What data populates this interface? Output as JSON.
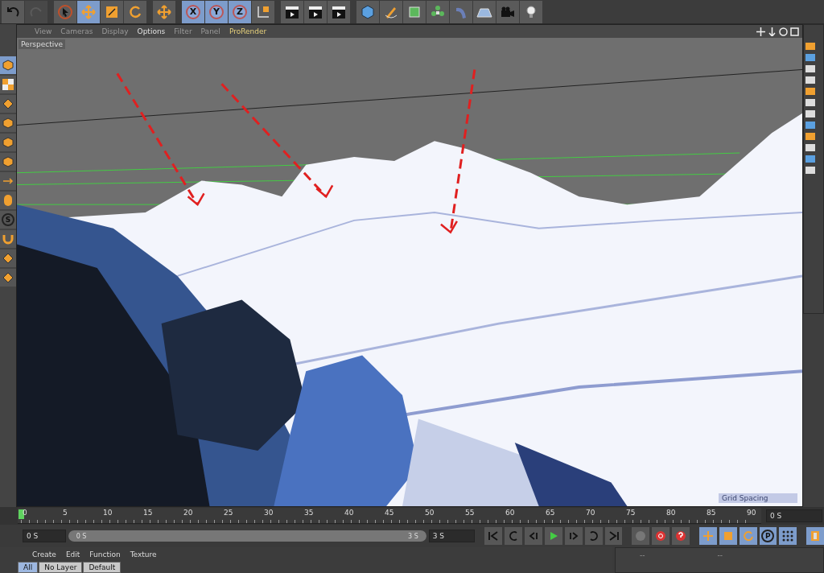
{
  "toolbar": [
    {
      "kind": "undo",
      "selected": false,
      "disabled": false
    },
    {
      "kind": "redo",
      "selected": false,
      "disabled": true
    },
    {
      "kind": "sep"
    },
    {
      "kind": "select",
      "selected": false,
      "disabled": false
    },
    {
      "kind": "move",
      "selected": true,
      "disabled": false
    },
    {
      "kind": "scale",
      "selected": false,
      "disabled": false
    },
    {
      "kind": "rotate",
      "selected": false,
      "disabled": false
    },
    {
      "kind": "sep"
    },
    {
      "kind": "move",
      "selected": false,
      "disabled": false
    },
    {
      "kind": "sep"
    },
    {
      "kind": "axis",
      "label": "X",
      "selected": true,
      "disabled": false
    },
    {
      "kind": "axis",
      "label": "Y",
      "selected": true,
      "disabled": false
    },
    {
      "kind": "axis",
      "label": "Z",
      "selected": true,
      "disabled": false
    },
    {
      "kind": "coords",
      "selected": false,
      "disabled": false
    },
    {
      "kind": "sep"
    },
    {
      "kind": "render",
      "selected": false,
      "disabled": false
    },
    {
      "kind": "render",
      "selected": false,
      "disabled": false
    },
    {
      "kind": "render",
      "selected": false,
      "disabled": false
    },
    {
      "kind": "sep"
    },
    {
      "kind": "cube",
      "selected": false,
      "disabled": false
    },
    {
      "kind": "pen",
      "selected": false,
      "disabled": false
    },
    {
      "kind": "subdiv",
      "selected": false,
      "disabled": false
    },
    {
      "kind": "cloner",
      "selected": false,
      "disabled": false
    },
    {
      "kind": "deformer",
      "selected": false,
      "disabled": false
    },
    {
      "kind": "floor",
      "selected": false,
      "disabled": false
    },
    {
      "kind": "camera",
      "selected": false,
      "disabled": false
    },
    {
      "kind": "light",
      "selected": false,
      "disabled": false
    }
  ],
  "left_tools": [
    {
      "kind": "cube",
      "selected": true
    },
    {
      "kind": "checker",
      "selected": false
    },
    {
      "kind": "grid",
      "selected": false
    },
    {
      "kind": "cube",
      "selected": false
    },
    {
      "kind": "cube",
      "selected": false
    },
    {
      "kind": "cube",
      "selected": false
    },
    {
      "kind": "arrow",
      "selected": false
    },
    {
      "kind": "mouse",
      "selected": false
    },
    {
      "kind": "s",
      "label": "S",
      "selected": false
    },
    {
      "kind": "magnet",
      "selected": false
    },
    {
      "kind": "grid",
      "selected": false
    },
    {
      "kind": "grid",
      "selected": false
    }
  ],
  "viewport": {
    "menu": [
      {
        "label": "View",
        "kind": "plain",
        "dimmed": true
      },
      {
        "label": "Cameras",
        "kind": "plain",
        "dimmed": true
      },
      {
        "label": "Display",
        "kind": "plain",
        "dimmed": true
      },
      {
        "label": "Options",
        "kind": "plain",
        "dimmed": false
      },
      {
        "label": "Filter",
        "kind": "plain",
        "dimmed": true
      },
      {
        "label": "Panel",
        "kind": "plain",
        "dimmed": true
      },
      {
        "label": "ProRender",
        "kind": "plugin",
        "dimmed": false
      }
    ],
    "camera": "Perspective",
    "grid_spacing": "Grid Spacing"
  },
  "timeline": {
    "ticks": [
      "0",
      "5",
      "10",
      "15",
      "20",
      "25",
      "30",
      "35",
      "40",
      "45",
      "50",
      "55",
      "60",
      "65",
      "70",
      "75",
      "80",
      "85",
      "90"
    ],
    "level": 0,
    "frame_field": "0 S"
  },
  "transport": {
    "start_field": "0 S",
    "range": {
      "start": "0 S",
      "end": "3 S",
      "level": 1
    },
    "end_field": "3 S",
    "buttons": [
      {
        "kind": "first",
        "selected": false
      },
      {
        "kind": "prevkey",
        "selected": false
      },
      {
        "kind": "prev",
        "selected": false
      },
      {
        "kind": "play",
        "selected": false
      },
      {
        "kind": "next",
        "selected": false
      },
      {
        "kind": "nextkey",
        "selected": false
      },
      {
        "kind": "last",
        "selected": false
      },
      {
        "kind": "sep"
      },
      {
        "kind": "motion",
        "selected": false
      },
      {
        "kind": "record",
        "selected": false
      },
      {
        "kind": "autokey",
        "selected": false
      },
      {
        "kind": "sep"
      },
      {
        "kind": "pos",
        "selected": true
      },
      {
        "kind": "scl",
        "selected": true
      },
      {
        "kind": "rot",
        "selected": true
      },
      {
        "kind": "param",
        "label": "P",
        "selected": true
      },
      {
        "kind": "dots",
        "selected": true
      },
      {
        "kind": "sep"
      },
      {
        "kind": "film",
        "selected": true
      }
    ]
  },
  "materials": {
    "menu": [
      "Create",
      "Edit",
      "Function",
      "Texture"
    ],
    "tabs": [
      {
        "label": "All",
        "selected": true
      },
      {
        "label": "No Layer",
        "selected": false
      },
      {
        "label": "Default",
        "selected": false
      }
    ]
  },
  "attributes": {
    "labels": [
      "--",
      "--"
    ]
  }
}
